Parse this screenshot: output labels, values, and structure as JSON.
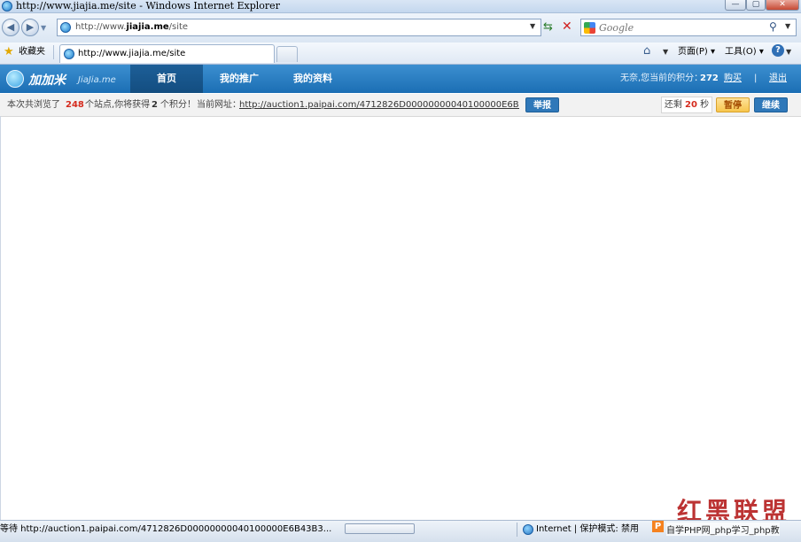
{
  "window": {
    "title": "http://www.jiajia.me/site - Windows Internet Explorer"
  },
  "address_bar": {
    "url_prefix": "http://www.",
    "url_domain": "jiajia.me",
    "url_path": "/site"
  },
  "search_box": {
    "placeholder": "Google"
  },
  "favorites": {
    "label": "收藏夹"
  },
  "tab": {
    "title": "http://www.jiajia.me/site"
  },
  "commands": {
    "page": "页面(P)",
    "tools": "工具(O)"
  },
  "site": {
    "logo_text": "加加米",
    "logo_sub": "JiaJia.me",
    "nav": [
      "首页",
      "我的推广",
      "我的资料"
    ],
    "user_prefix": "无奈,您当前的积分：",
    "points": "272",
    "buy": "购买",
    "divider": "|",
    "logout": "退出"
  },
  "info": {
    "browsed_prefix": "本次共浏览了",
    "browsed_count": "248",
    "sites_text": "个站点,你将获得",
    "earn_points": "2",
    "points_text": "个积分！",
    "current_label": "当前网址：",
    "current_url": "http://auction1.paipai.com/4712826D00000000040100000E6B43B3",
    "report_btn": "举报",
    "remaining_prefix": "还剩",
    "remaining_seconds": "20",
    "remaining_suffix": "秒",
    "pause_btn": "暂停",
    "continue_btn": "继续"
  },
  "status": {
    "waiting": "等待 http://auction1.paipai.com/4712826D00000000040100000E6B43B3...",
    "zone": "Internet | 保护模式: 禁用"
  },
  "watermark": {
    "text": "红黑联盟",
    "badge": "P",
    "caption": "自学PHP网_php学习_php教"
  },
  "colors": {
    "site_header": "#1b6eb4",
    "accent_red": "#d52b1e",
    "pause": "#f7c64d"
  }
}
